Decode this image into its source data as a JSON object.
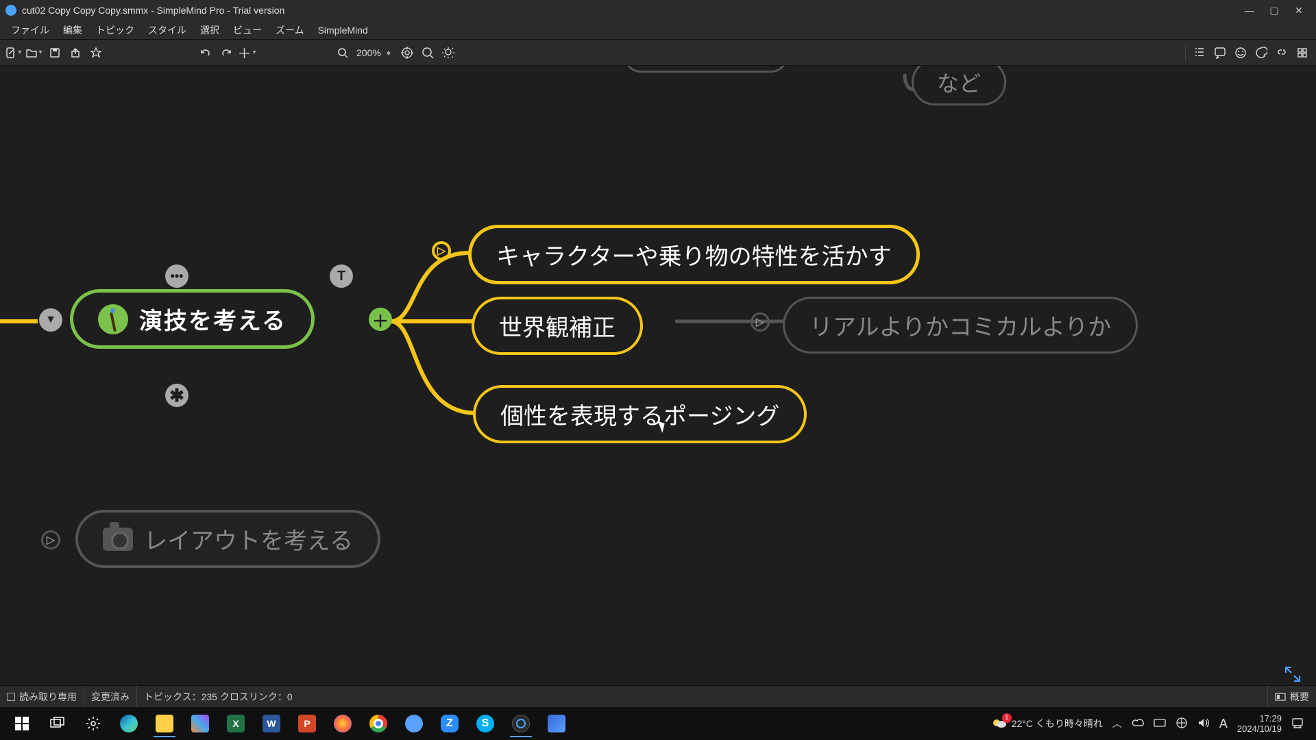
{
  "window": {
    "title": "cut02 Copy Copy Copy.smmx - SimpleMind Pro - Trial version"
  },
  "menu": {
    "items": [
      "ファイル",
      "編集",
      "トピック",
      "スタイル",
      "選択",
      "ビュー",
      "ズーム",
      "SimpleMind"
    ]
  },
  "toolbar": {
    "zoom_label": "200%"
  },
  "nodes": {
    "root": "演技を考える",
    "child1": "キャラクターや乗り物の特性を活かす",
    "child2": "世界観補正",
    "child3": "個性を表現するポージング",
    "dim_right": "リアルよりかコミカルよりか",
    "dim_top": "など",
    "dim_bottom": "レイアウトを考える"
  },
  "status": {
    "readonly": "読み取り専用",
    "modified": "変更済み",
    "topics": "トピックス：235 クロスリンク：0",
    "overview": "概要"
  },
  "system": {
    "weather": "22°C くもり時々晴れ",
    "time": "17:29",
    "date": "2024/10/19",
    "notif_badge": "1"
  }
}
